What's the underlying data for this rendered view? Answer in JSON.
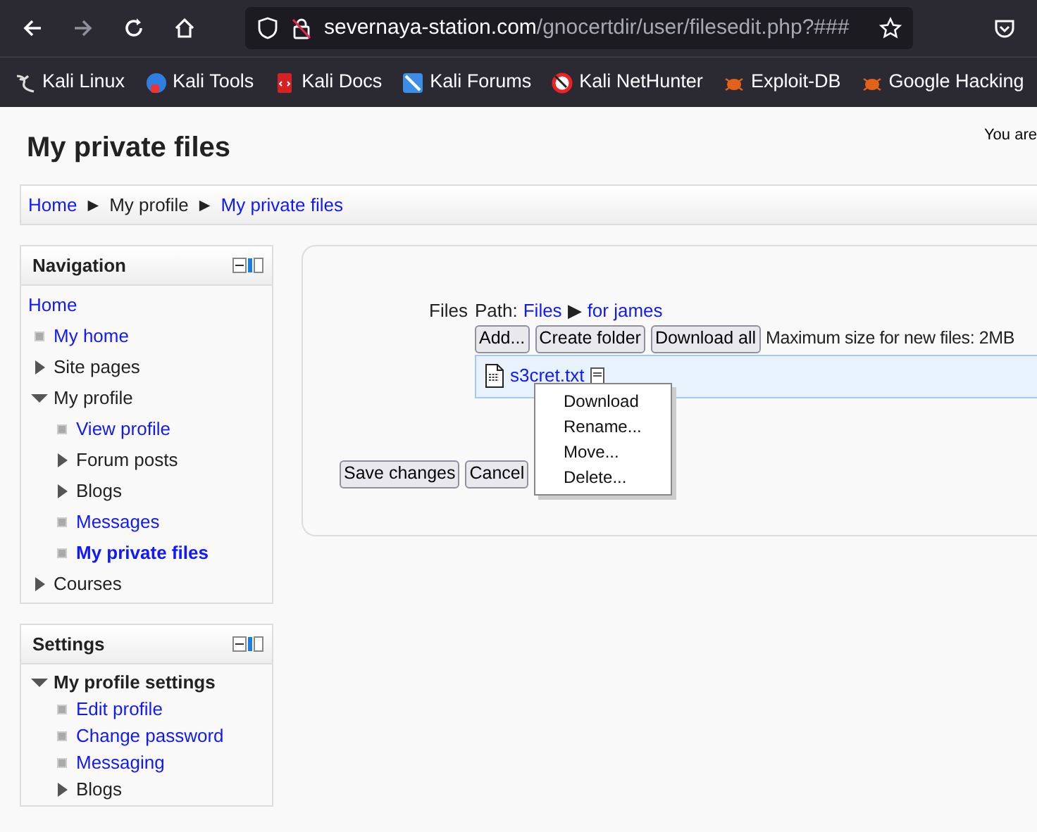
{
  "browser": {
    "back_enabled": true,
    "forward_enabled": false,
    "url": {
      "host": "severnaya-station.com",
      "path": "/gnocertdir/user/filesedit.php?###"
    },
    "bookmarks": [
      {
        "label": "Kali Linux"
      },
      {
        "label": "Kali Tools"
      },
      {
        "label": "Kali Docs"
      },
      {
        "label": "Kali Forums"
      },
      {
        "label": "Kali NetHunter"
      },
      {
        "label": "Exploit-DB"
      },
      {
        "label": "Google Hacking"
      }
    ]
  },
  "page": {
    "title": "My private files",
    "login_info": "You are",
    "breadcrumb": [
      {
        "label": "Home",
        "link": true
      },
      {
        "label": "My profile",
        "link": false
      },
      {
        "label": "My private files",
        "link": true
      }
    ],
    "breadcrumb_separator": "►",
    "blocks": [
      {
        "title": "Navigation",
        "items": [
          {
            "label": "Home",
            "kind": "root",
            "children": [
              {
                "label": "My home",
                "kind": "link",
                "selected": false
              },
              {
                "label": "Site pages",
                "kind": "branch",
                "expanded": false
              },
              {
                "label": "My profile",
                "kind": "branch",
                "expanded": true,
                "children": [
                  {
                    "label": "View profile",
                    "kind": "link",
                    "selected": false
                  },
                  {
                    "label": "Forum posts",
                    "kind": "branch",
                    "expanded": false
                  },
                  {
                    "label": "Blogs",
                    "kind": "branch",
                    "expanded": false
                  },
                  {
                    "label": "Messages",
                    "kind": "link",
                    "selected": false
                  },
                  {
                    "label": "My private files",
                    "kind": "link",
                    "selected": true
                  }
                ]
              },
              {
                "label": "Courses",
                "kind": "branch",
                "expanded": false
              }
            ]
          }
        ]
      },
      {
        "title": "Settings",
        "items": [
          {
            "label": "My profile settings",
            "kind": "heading",
            "expanded": true,
            "children": [
              {
                "label": "Edit profile",
                "kind": "link",
                "selected": false
              },
              {
                "label": "Change password",
                "kind": "link",
                "selected": false
              },
              {
                "label": "Messaging",
                "kind": "link",
                "selected": false
              },
              {
                "label": "Blogs",
                "kind": "branch",
                "expanded": false
              }
            ]
          }
        ]
      }
    ],
    "files": {
      "label": "Files",
      "path_label": "Path:",
      "path": [
        "Files",
        "for james"
      ],
      "path_separator": "▶",
      "buttons": [
        "Add...",
        "Create folder",
        "Download all"
      ],
      "max_size": "Maximum size for new files: 2MB",
      "file_name": "s3cret.txt",
      "context_menu": [
        "Download",
        "Rename...",
        "Move...",
        "Delete..."
      ],
      "form_buttons": [
        "Save changes",
        "Cancel"
      ]
    }
  }
}
